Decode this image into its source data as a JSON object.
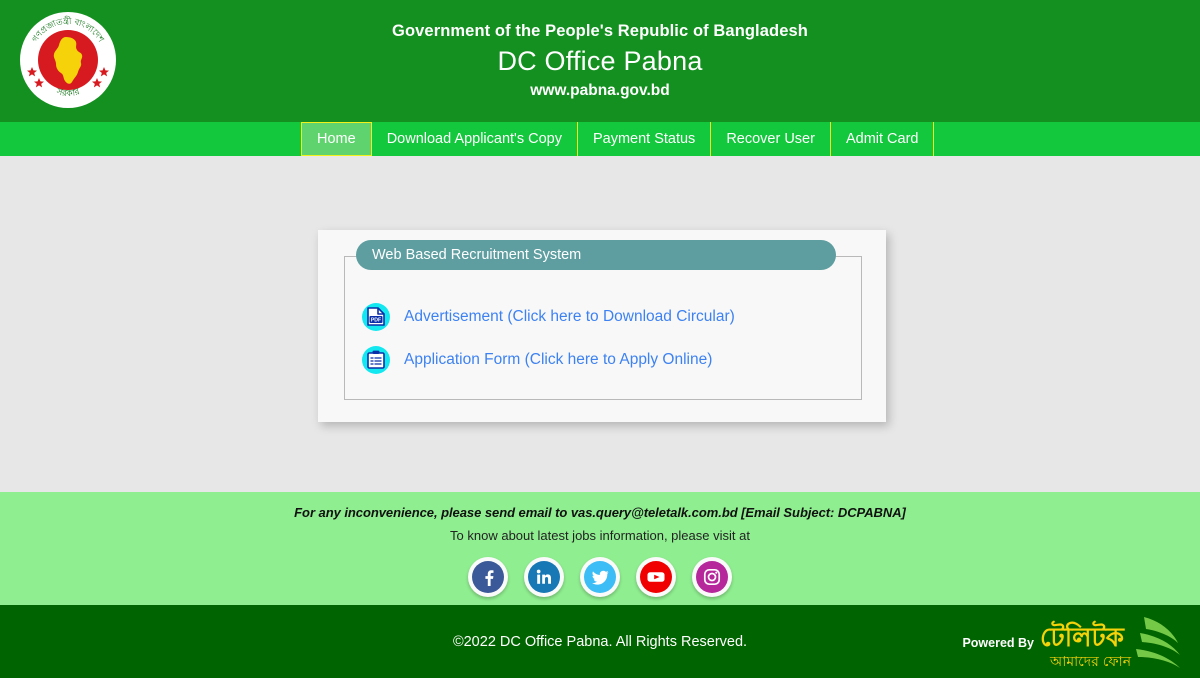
{
  "header": {
    "emblem_alt": "bangladesh-government-emblem",
    "gov_line": "Government of the People's Republic of Bangladesh",
    "office_line": "DC Office Pabna",
    "url_line": "www.pabna.gov.bd"
  },
  "nav": {
    "items": [
      {
        "label": "Home",
        "active": true
      },
      {
        "label": "Download Applicant's Copy",
        "active": false
      },
      {
        "label": "Payment Status",
        "active": false
      },
      {
        "label": "Recover User",
        "active": false
      },
      {
        "label": "Admit Card",
        "active": false
      }
    ]
  },
  "card": {
    "legend": "Web Based Recruitment System",
    "links": [
      {
        "icon": "pdf-file-icon",
        "label": "Advertisement (Click here to Download Circular)"
      },
      {
        "icon": "application-form-icon",
        "label": "Application Form (Click here to Apply Online)"
      }
    ]
  },
  "footer": {
    "line1": "For any inconvenience, please send email to vas.query@teletalk.com.bd [Email Subject: DCPABNA]",
    "line2": "To know about latest jobs information, please visit at",
    "socials": [
      {
        "name": "facebook",
        "color": "#3b5998"
      },
      {
        "name": "linkedin",
        "color": "#1878b5"
      },
      {
        "name": "twitter",
        "color": "#3dbdf5"
      },
      {
        "name": "youtube",
        "color": "#f00000"
      },
      {
        "name": "instagram",
        "color": "#b5279b"
      }
    ]
  },
  "bottom": {
    "copyright": "©2022 DC Office Pabna. All Rights Reserved.",
    "powered_label": "Powered By",
    "brand_main": "টেলিটক",
    "brand_tagline": "আমাদের ফোন"
  },
  "colors": {
    "header_green": "#13901f",
    "nav_green": "#13c83c",
    "nav_active": "#5fd46e",
    "nav_divider": "#f2f21a",
    "page_bg": "#e7e7e7",
    "legend_teal": "#5f9ea0",
    "link_blue": "#3d82f2",
    "icon_cyan": "#13e8f0",
    "footer_green": "#8fee90",
    "bottom_green": "#006400"
  }
}
